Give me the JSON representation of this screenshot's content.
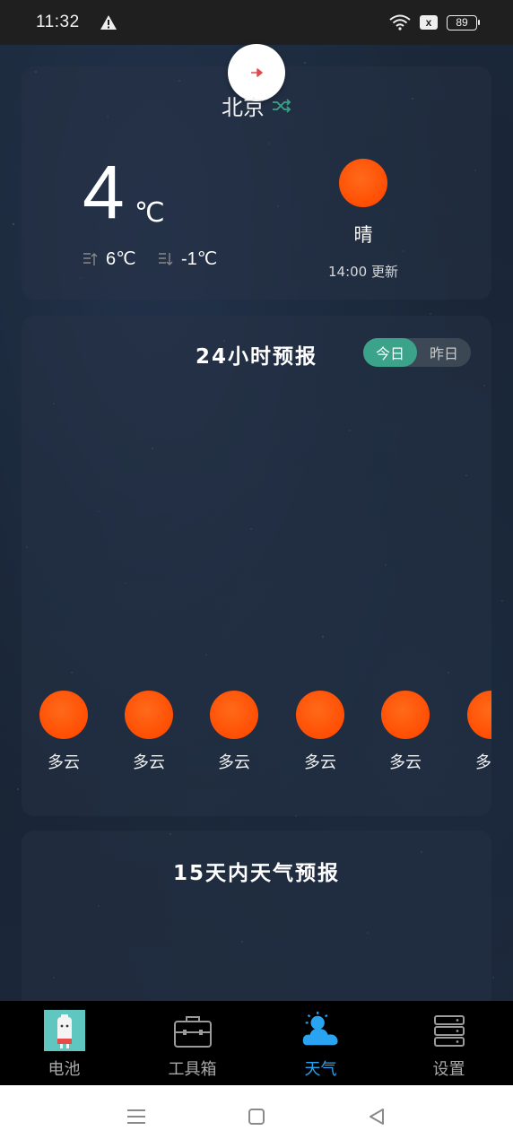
{
  "status_bar": {
    "time": "11:32",
    "battery": "89",
    "sim_icon": "x"
  },
  "current": {
    "city": "北京",
    "temperature": "4",
    "unit": "℃",
    "high": "6℃",
    "low": "-1℃",
    "condition": "晴",
    "update_time": "14:00 更新"
  },
  "hourly": {
    "title": "24小时预报",
    "toggle_today": "今日",
    "toggle_yesterday": "昨日",
    "items": [
      {
        "label": "多云"
      },
      {
        "label": "多云"
      },
      {
        "label": "多云"
      },
      {
        "label": "多云"
      },
      {
        "label": "多云"
      },
      {
        "label": "多云"
      }
    ]
  },
  "daily": {
    "title": "15天内天气预报"
  },
  "tabs": [
    {
      "label": "电池",
      "icon": "battery-icon"
    },
    {
      "label": "工具箱",
      "icon": "toolbox-icon"
    },
    {
      "label": "天气",
      "icon": "weather-icon",
      "active": true
    },
    {
      "label": "设置",
      "icon": "server-icon"
    }
  ],
  "colors": {
    "accent_green": "#3aa38a",
    "sun_orange": "#ff4a00",
    "active_tab": "#2aa3f0"
  }
}
